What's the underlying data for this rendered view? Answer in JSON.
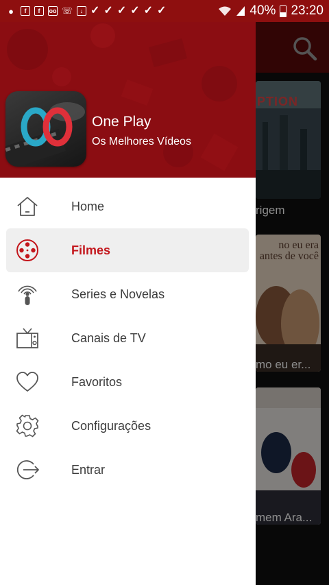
{
  "status_bar": {
    "battery_percent": "40%",
    "time": "23:20"
  },
  "app": {
    "name": "One Play",
    "tagline": "Os Melhores Vídeos",
    "accent_color": "#c3161c",
    "header_color": "#8b0d12"
  },
  "menu": {
    "items": [
      {
        "label": "Home",
        "icon": "home-icon",
        "active": false
      },
      {
        "label": "Filmes",
        "icon": "film-reel-icon",
        "active": true
      },
      {
        "label": "Series e Novelas",
        "icon": "broadcast-icon",
        "active": false
      },
      {
        "label": "Canais de TV",
        "icon": "tv-icon",
        "active": false
      },
      {
        "label": "Favoritos",
        "icon": "heart-icon",
        "active": false
      },
      {
        "label": "Configurações",
        "icon": "gear-icon",
        "active": false
      },
      {
        "label": "Entrar",
        "icon": "login-icon",
        "active": false
      }
    ]
  },
  "background": {
    "posters": [
      {
        "title_fragment": "rigem",
        "poster_text": "PTION"
      },
      {
        "title_fragment": "mo eu er...",
        "poster_text": "no eu era antes de você"
      },
      {
        "title_fragment": "mem Ara..."
      }
    ]
  }
}
